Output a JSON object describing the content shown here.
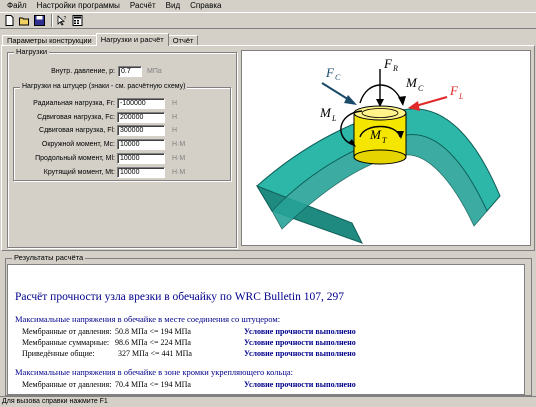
{
  "menu": [
    "Файл",
    "Настройки программы",
    "Расчёт",
    "Вид",
    "Справка"
  ],
  "toolbar": {
    "icons": [
      "new-file-icon",
      "open-file-icon",
      "save-icon",
      "pointer-help-icon",
      "calculator-icon"
    ]
  },
  "tabs": [
    {
      "label": "Параметры конструкции",
      "active": false
    },
    {
      "label": "Нагрузки и расчёт",
      "active": true
    },
    {
      "label": "Отчёт",
      "active": false
    }
  ],
  "loads": {
    "group_title": "Нагрузки",
    "pressure": {
      "label": "Внутр. давление, p:",
      "value": "0.7",
      "unit": "МПа"
    },
    "nozzle_group_title": "Нагрузки на штуцер (знаки - см. расчётную схему)",
    "rows": [
      {
        "label": "Радиальная нагрузка, Fr:",
        "value": "-100000",
        "unit": "Н"
      },
      {
        "label": "Сдвиговая нагрузка, Fc:",
        "value": "200000",
        "unit": "Н"
      },
      {
        "label": "Сдвиговая нагрузка, Fl:",
        "value": "300000",
        "unit": "Н"
      },
      {
        "label": "Окружной момент, Mc:",
        "value": "10000",
        "unit": "Н·М"
      },
      {
        "label": "Продольный момент, Ml:",
        "value": "10000",
        "unit": "Н·М"
      },
      {
        "label": "Крутящий момент, Mt:",
        "value": "10000",
        "unit": "Н·М"
      }
    ]
  },
  "figure_labels": {
    "fr": "F",
    "fr_sub": "R",
    "fc": "F",
    "fc_sub": "C",
    "fl": "F",
    "fl_sub": "L",
    "mc": "M",
    "mc_sub": "C",
    "ml": "M",
    "ml_sub": "L",
    "mt": "M",
    "mt_sub": "T"
  },
  "results": {
    "group_title": "Результаты расчёта",
    "title": "Расчёт прочности узла врезки в обечайку по WRC Bulletin 107, 297",
    "section1": "Максимальные напряжения в обечайке в месте соединения со штуцером:",
    "section1_rows": [
      {
        "label": "Мембранные от давления:",
        "value": "50.8 МПа <= 194 МПа",
        "status": "Условие прочности выполнено"
      },
      {
        "label": "Мембранные суммарные:",
        "value": "98.6 МПа <= 224 МПа",
        "status": "Условие прочности выполнено"
      },
      {
        "label": "Приведённые общие:",
        "value": "327 МПа <= 441 МПа",
        "status": "Условие прочности выполнено"
      }
    ],
    "section2": "Максимальные напряжения в обечайке в зоне кромки укрепляющего кольца:",
    "section2_rows": [
      {
        "label": "Мембранные от давления:",
        "value": "70.4 МПа <= 194 МПа",
        "status": "Условие прочности выполнено"
      }
    ]
  },
  "status_bar": "Для вызова справки нажмите F1",
  "colors": {
    "shell": "#2cb7a9",
    "nozzle": "#f5e600",
    "force_red": "#e02828",
    "force_dark": "#1a4a6a"
  }
}
